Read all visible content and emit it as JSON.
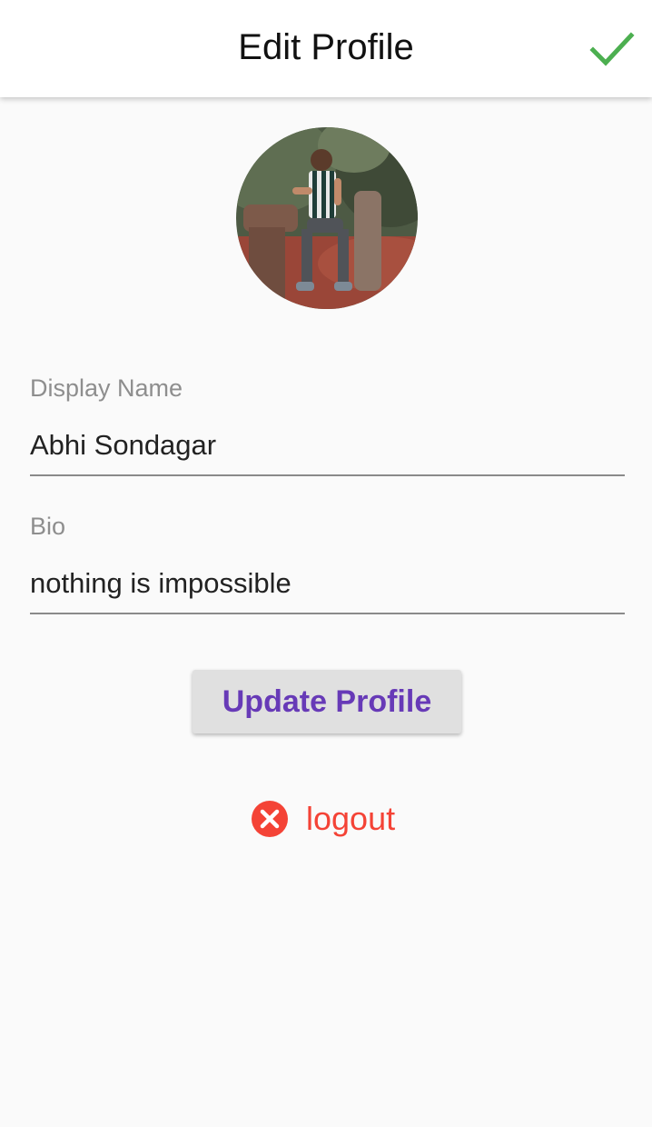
{
  "appbar": {
    "title": "Edit Profile",
    "confirm_icon": "check-icon"
  },
  "profile": {
    "avatar_alt": "profile photo"
  },
  "fields": {
    "display_name": {
      "label": "Display Name",
      "value": "Abhi Sondagar"
    },
    "bio": {
      "label": "Bio",
      "value": "nothing is impossible"
    }
  },
  "actions": {
    "update_label": "Update Profile",
    "logout_label": "logout",
    "logout_icon": "cancel-icon"
  },
  "colors": {
    "accent_check": "#4caf50",
    "button_text": "#673ab7",
    "logout": "#f44336"
  }
}
